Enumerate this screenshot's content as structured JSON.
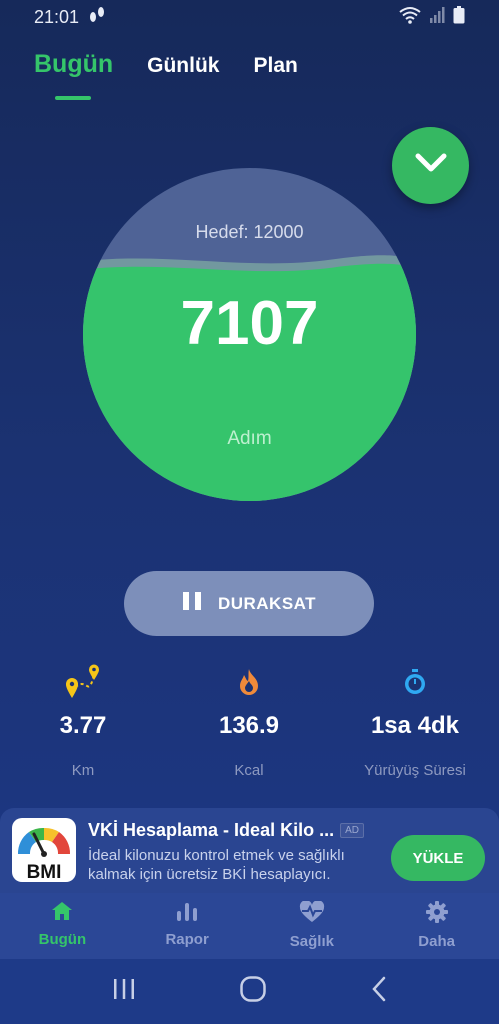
{
  "status_bar": {
    "time": "21:01"
  },
  "tabs": [
    {
      "label": "Bugün",
      "active": true
    },
    {
      "label": "Günlük",
      "active": false
    },
    {
      "label": "Plan",
      "active": false
    }
  ],
  "goal": {
    "label": "Hedef: 12000"
  },
  "steps": {
    "value": "7107",
    "unit": "Adım",
    "progress": 0.59
  },
  "pause_button": {
    "label": "DURAKSAT"
  },
  "stats": [
    {
      "value": "3.77",
      "label": "Km",
      "icon": "route-pin-icon"
    },
    {
      "value": "136.9",
      "label": "Kcal",
      "icon": "flame-icon"
    },
    {
      "value": "1sa 4dk",
      "label": "Yürüyüş Süresi",
      "icon": "stopwatch-icon"
    }
  ],
  "ad": {
    "title": "VKİ Hesaplama - Ideal Kilo ...",
    "badge": "AD",
    "description": "İdeal kilonuzu kontrol etmek ve sağlıklı kalmak için ücretsiz BKİ hesaplayıcı.",
    "install": "YÜKLE",
    "logo_text": "BMI"
  },
  "nav": [
    {
      "label": "Bugün",
      "icon": "home-icon",
      "active": true
    },
    {
      "label": "Rapor",
      "icon": "bar-chart-icon",
      "active": false
    },
    {
      "label": "Sağlık",
      "icon": "heart-pulse-icon",
      "active": false
    },
    {
      "label": "Daha",
      "icon": "gear-icon",
      "active": false
    }
  ],
  "colors": {
    "accent": "#35c56a",
    "background": "#1b3272",
    "nav_background": "#2b4796"
  }
}
